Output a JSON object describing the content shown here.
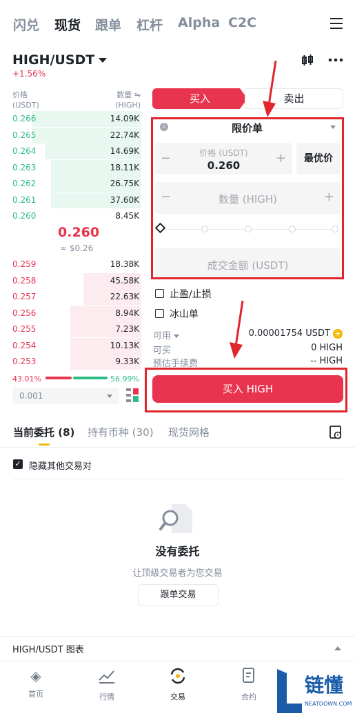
{
  "top_tabs": [
    "闪兑",
    "现货",
    "跟单",
    "杠杆",
    "Alpha",
    "C2C"
  ],
  "pair": {
    "name": "HIGH/USDT",
    "change": "+1.56%"
  },
  "orderbook": {
    "price_header": "价格",
    "price_unit": "(USDT)",
    "qty_header": "数量 ⇋",
    "qty_unit": "(HIGH)",
    "bids": [
      {
        "price": "0.266",
        "qty": "14.09K",
        "depth": 0.85
      },
      {
        "price": "0.265",
        "qty": "22.74K",
        "depth": 0.85
      },
      {
        "price": "0.264",
        "qty": "14.69K",
        "depth": 0.75
      },
      {
        "price": "0.263",
        "qty": "18.11K",
        "depth": 0.7
      },
      {
        "price": "0.262",
        "qty": "26.75K",
        "depth": 0.7
      },
      {
        "price": "0.261",
        "qty": "37.60K",
        "depth": 0.7
      },
      {
        "price": "0.260",
        "qty": "8.45K",
        "depth": 0.0
      }
    ],
    "mid_price": "0.260",
    "mid_usd": "≈ $0.26",
    "asks": [
      {
        "price": "0.259",
        "qty": "18.38K",
        "depth": 0.0
      },
      {
        "price": "0.258",
        "qty": "45.58K",
        "depth": 0.45
      },
      {
        "price": "0.257",
        "qty": "22.63K",
        "depth": 0.45
      },
      {
        "price": "0.256",
        "qty": "8.94K",
        "depth": 0.55
      },
      {
        "price": "0.255",
        "qty": "7.23K",
        "depth": 0.55
      },
      {
        "price": "0.254",
        "qty": "10.13K",
        "depth": 0.55
      },
      {
        "price": "0.253",
        "qty": "9.33K",
        "depth": 0.55
      }
    ],
    "buy_ratio": "43.01%",
    "sell_ratio": "56.99%",
    "precision": "0.001"
  },
  "order_form": {
    "buy_tab": "买入",
    "sell_tab": "卖出",
    "order_type": "限价单",
    "price_label": "价格 (USDT)",
    "price_value": "0.260",
    "best_price": "最优价",
    "qty_placeholder": "数量 (HIGH)",
    "total_placeholder": "成交金额 (USDT)",
    "tp_sl": "止盈/止损",
    "iceberg": "冰山单",
    "available_label": "可用",
    "available_value": "0.00001754 USDT",
    "can_buy_label": "可买",
    "can_buy_value": "0 HIGH",
    "fee_label": "预估手续费",
    "fee_value": "-- HIGH",
    "buy_button": "买入 HIGH"
  },
  "bottom_tabs": [
    "当前委托 (8)",
    "持有币种 (30)",
    "现货网格"
  ],
  "hide_pairs": "隐藏其他交易对",
  "empty": {
    "title": "没有委托",
    "subtitle": "让顶级交易者为您交易",
    "button": "跟单交易"
  },
  "chart_row": "HIGH/USDT 图表",
  "nav": [
    "首页",
    "行情",
    "交易",
    "合约",
    ""
  ],
  "watermark": {
    "text": "链懂",
    "sub": "NEATDOWN.COM"
  },
  "colors": {
    "buy": "#e8344f",
    "green": "#2ebd85",
    "accent": "#f0b90b",
    "highlight": "#e0252b"
  }
}
